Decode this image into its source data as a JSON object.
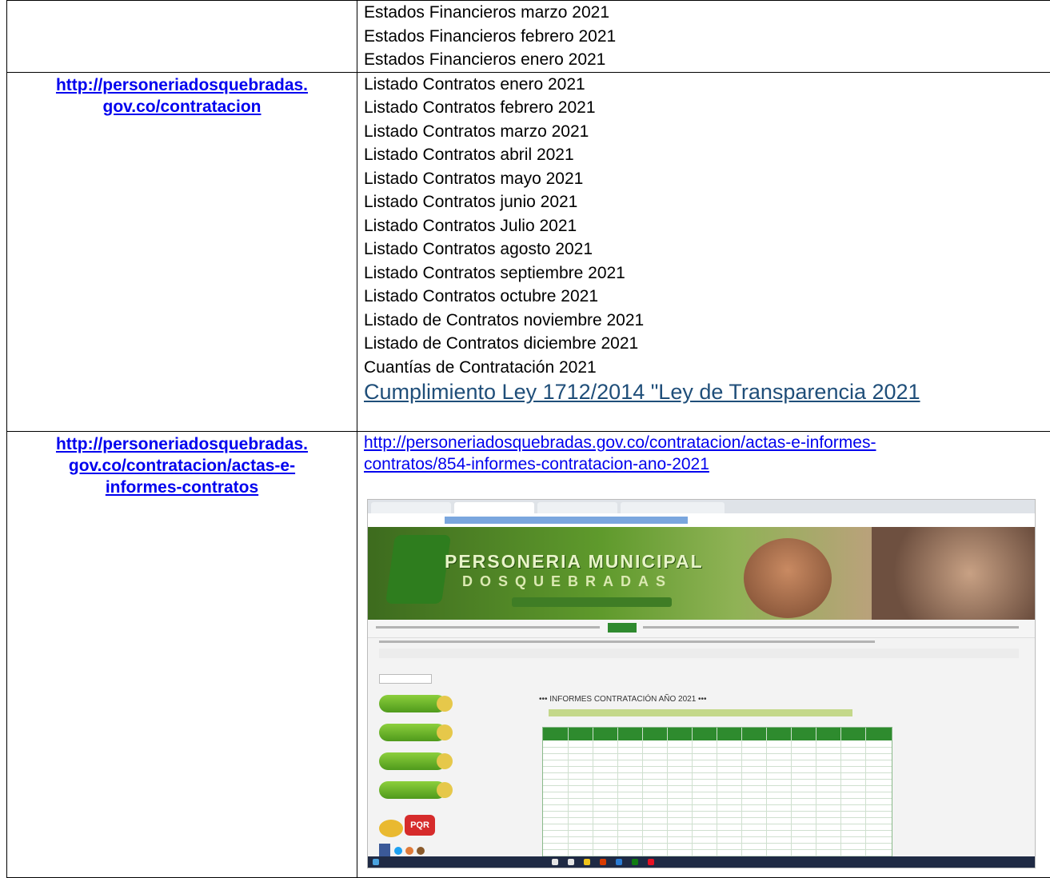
{
  "row1": {
    "items": [
      "Estados Financieros marzo 2021",
      "Estados Financieros febrero 2021",
      "Estados Financieros enero 2021"
    ]
  },
  "row2": {
    "link": "http://personeriadosquebradas.gov.co/contratacion",
    "link_line1": "http://personeriadosquebradas.",
    "link_line2": "gov.co/contratacion",
    "items": [
      "Listado Contratos enero 2021",
      "Listado Contratos febrero 2021",
      "Listado Contratos marzo 2021",
      "Listado Contratos abril 2021",
      "Listado Contratos mayo 2021",
      "Listado Contratos junio 2021",
      "Listado Contratos Julio 2021",
      "Listado Contratos agosto 2021",
      "Listado Contratos septiembre 2021",
      "Listado Contratos octubre 2021",
      "Listado de Contratos noviembre 2021",
      "Listado de Contratos diciembre 2021",
      "Cuantías de Contratación 2021"
    ],
    "big_link": "Cumplimiento Ley 1712/2014 \"Ley de Transparencia 2021"
  },
  "row3": {
    "link_line1": "http://personeriadosquebradas.",
    "link_line2": "gov.co/contratacion/actas-e-",
    "link_line3": "informes-contratos",
    "url_line1": "http://personeriadosquebradas.gov.co/contratacion/actas-e-informes-",
    "url_line2": "contratos/854-informes-contratacion-ano-2021",
    "screenshot": {
      "banner_line1": "PERSONERIA MUNICIPAL",
      "banner_line2": "DOSQUEBRADAS",
      "report_title": "••• INFORMES CONTRATACIÓN AÑO 2021 •••",
      "pqr_label": "PQR"
    }
  }
}
